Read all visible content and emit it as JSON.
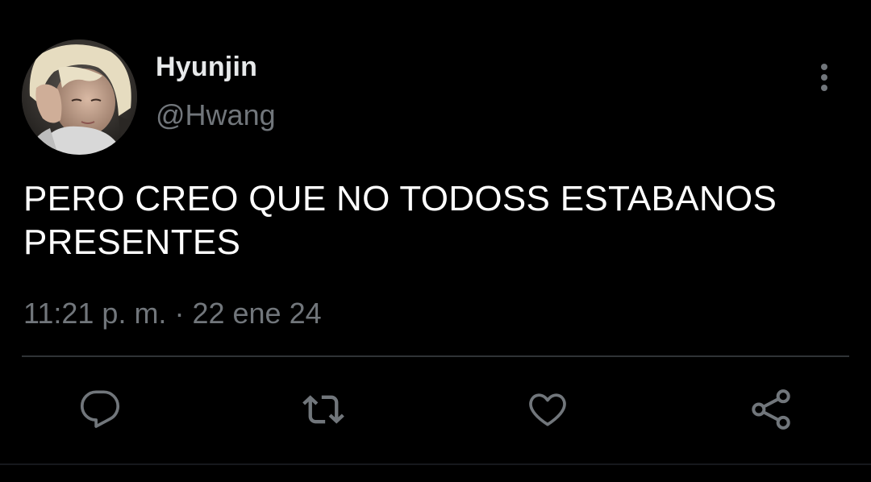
{
  "tweet": {
    "author": {
      "name": "Hyunjin",
      "handle": "@Hwang",
      "avatar": "profile-photo"
    },
    "text": "PERO CREO QUE NO TODOSS ESTABANOS PRESENTES",
    "time": "11:21 p. m.",
    "separator": "·",
    "date": "22 ene 24"
  },
  "actions": [
    {
      "icon": "reply-icon"
    },
    {
      "icon": "retweet-icon"
    },
    {
      "icon": "like-icon"
    },
    {
      "icon": "share-icon"
    }
  ],
  "colors": {
    "background": "#000000",
    "primary_text": "#ffffff",
    "secondary_text": "#71767b",
    "divider": "#2f3336",
    "icon": "#71767b"
  }
}
